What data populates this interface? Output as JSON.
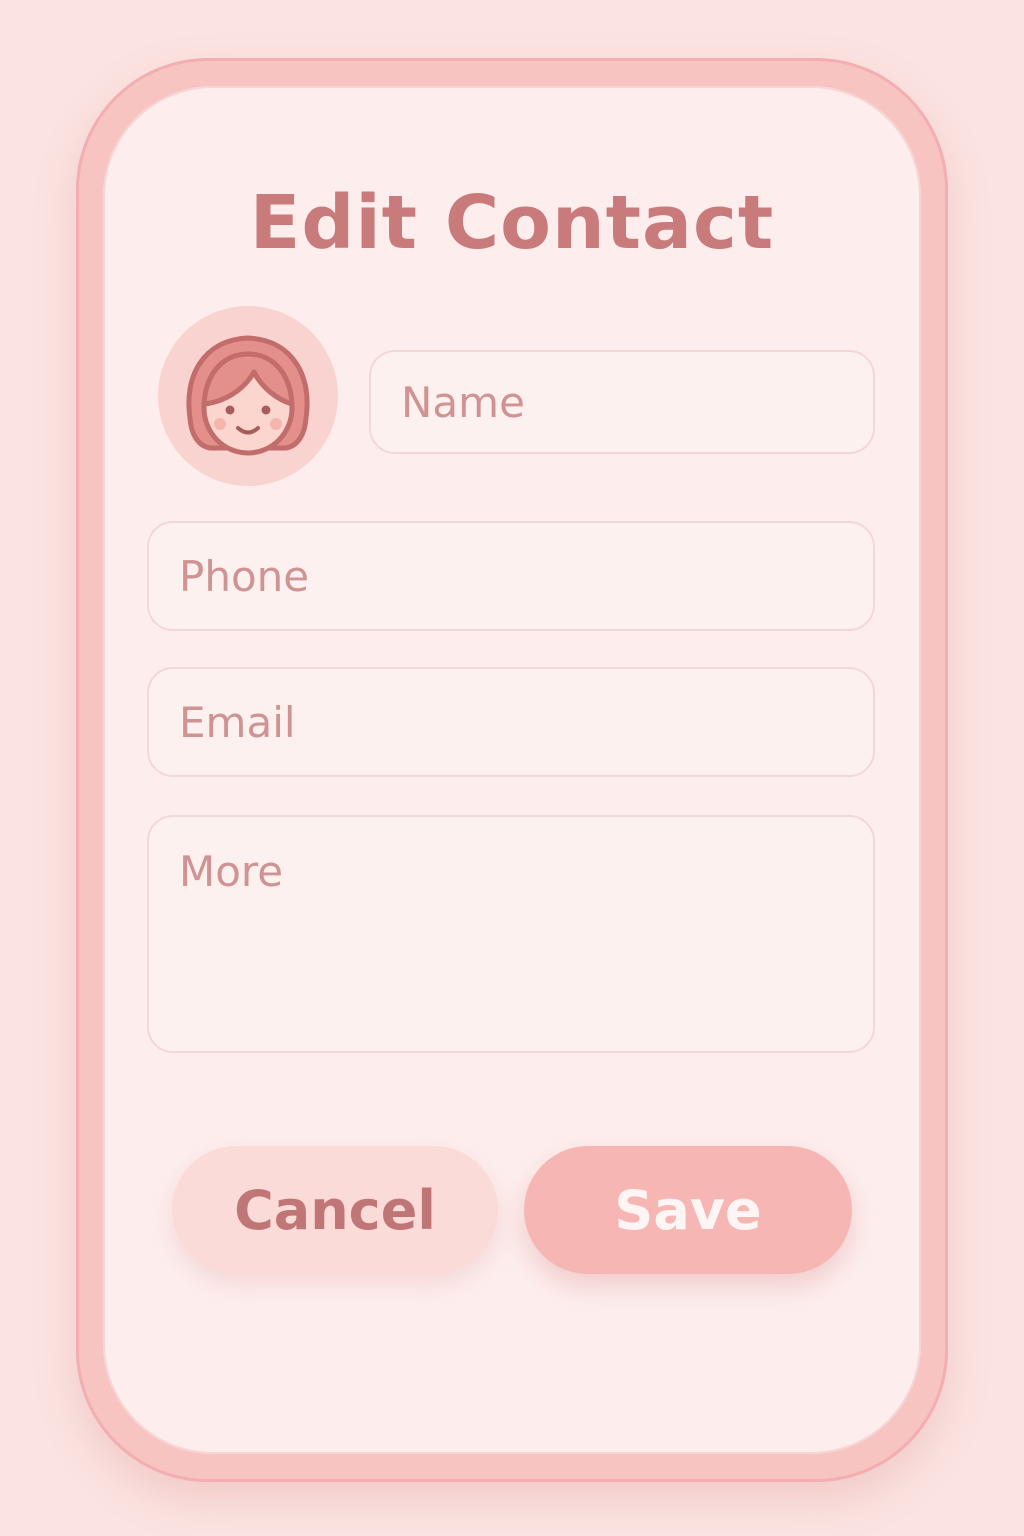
{
  "app": {
    "title": "Edit Contact"
  },
  "avatar": {
    "icon": "girl-avatar-icon"
  },
  "form": {
    "name_placeholder": "Name",
    "phone_placeholder": "Phone",
    "email_placeholder": "Email",
    "more_placeholder": "More"
  },
  "buttons": {
    "cancel_label": "Cancel",
    "save_label": "Save"
  },
  "colors": {
    "background": "#fbe3e1",
    "accent": "#f6b7b4",
    "text": "#c97a7a"
  }
}
